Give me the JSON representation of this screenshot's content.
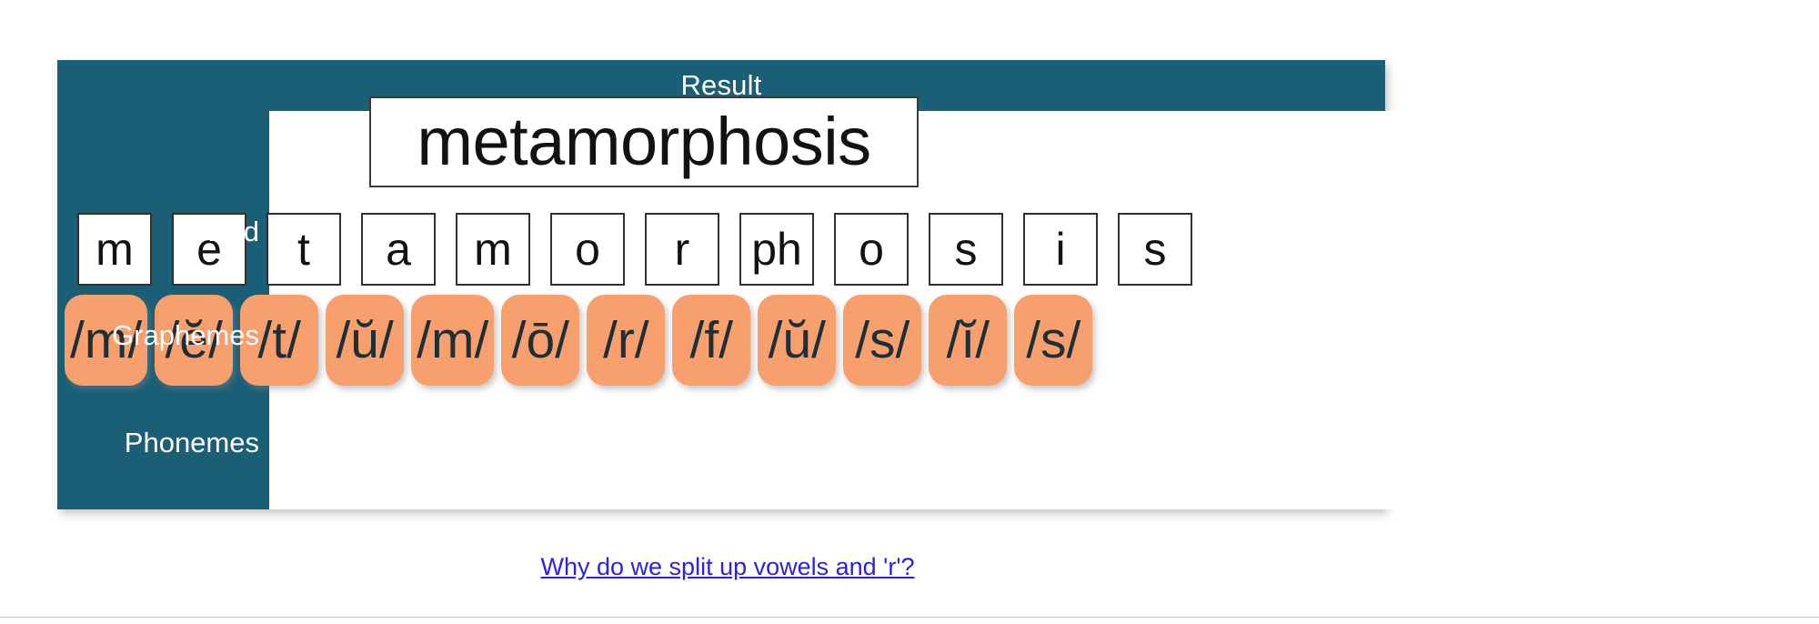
{
  "card": {
    "title": "Result",
    "accent_teal": "#1a5f75",
    "chip_orange": "#f7a06e",
    "link_blue": "#2a22e0"
  },
  "rows": {
    "word": {
      "label": "Word",
      "value": "metamorphosis"
    },
    "graphemes": {
      "label": "Graphemes",
      "items": [
        "m",
        "e",
        "t",
        "a",
        "m",
        "o",
        "r",
        "ph",
        "o",
        "s",
        "i",
        "s"
      ]
    },
    "phonemes": {
      "label": "Phonemes",
      "items": [
        "/m/",
        "/ĕ/",
        "/t/",
        "/ŭ/",
        "/m/",
        "/ō/",
        "/r/",
        "/f/",
        "/ŭ/",
        "/s/",
        "/ĭ/",
        "/s/"
      ]
    }
  },
  "footer": {
    "link_text": "Why do we split up vowels and 'r'?"
  }
}
